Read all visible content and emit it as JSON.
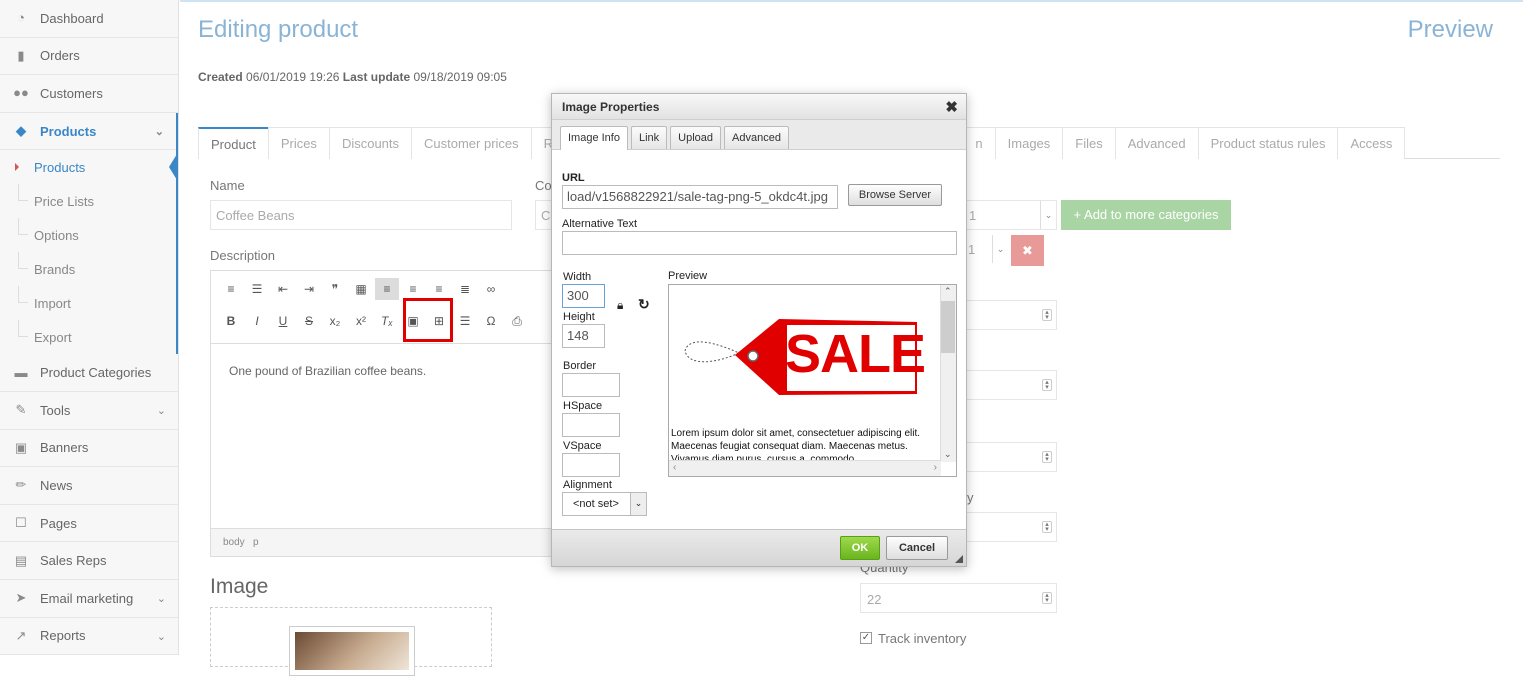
{
  "sidebar": {
    "items": [
      {
        "label": "Dashboard",
        "icon": "dashboard-icon"
      },
      {
        "label": "Orders",
        "icon": "file-icon"
      },
      {
        "label": "Customers",
        "icon": "users-icon"
      },
      {
        "label": "Products",
        "icon": "tag-icon"
      },
      {
        "label": "Product Categories",
        "icon": "folder-icon"
      },
      {
        "label": "Tools",
        "icon": "wrench-icon"
      },
      {
        "label": "Banners",
        "icon": "image-icon"
      },
      {
        "label": "News",
        "icon": "pencil-icon"
      },
      {
        "label": "Pages",
        "icon": "edit-icon"
      },
      {
        "label": "Sales Reps",
        "icon": "briefcase-icon"
      },
      {
        "label": "Email marketing",
        "icon": "send-icon"
      },
      {
        "label": "Reports",
        "icon": "chart-icon"
      }
    ],
    "product_sub": [
      "Products",
      "Price Lists",
      "Options",
      "Brands",
      "Import",
      "Export"
    ]
  },
  "header": {
    "title": "Editing product",
    "preview": "Preview",
    "created_label": "Created",
    "created_value": "06/01/2019 19:26",
    "updated_label": "Last update",
    "updated_value": "09/18/2019 09:05"
  },
  "tabs": [
    "Product",
    "Prices",
    "Discounts",
    "Customer prices",
    "Rela",
    "n",
    "Images",
    "Files",
    "Advanced",
    "Product status rules",
    "Access"
  ],
  "form": {
    "name_label": "Name",
    "name_value": "Coffee Beans",
    "code_label": "Co",
    "code_value": "CF",
    "description_label": "Description",
    "description_text": "One pound of Brazilian coffee beans.",
    "path_body": "body",
    "path_p": "p",
    "image_title": "Image",
    "add_categories": "+ Add to more categories",
    "category_select": "1",
    "category_select2": "1",
    "partial_label": "y",
    "quantity_label": "Quantity",
    "quantity_value": "22",
    "track_inventory": "Track inventory"
  },
  "dialog": {
    "title": "Image Properties",
    "tabs": [
      "Image Info",
      "Link",
      "Upload",
      "Advanced"
    ],
    "url_label": "URL",
    "url_value": "load/v1568822921/sale-tag-png-5_okdc4t.jpg",
    "browse": "Browse Server",
    "alt_label": "Alternative Text",
    "alt_value": "",
    "width_label": "Width",
    "width_value": "300",
    "height_label": "Height",
    "height_value": "148",
    "border_label": "Border",
    "hspace_label": "HSpace",
    "vspace_label": "VSpace",
    "alignment_label": "Alignment",
    "alignment_value": "<not set>",
    "preview_label": "Preview",
    "sale_text": "SALE",
    "lorem": "Lorem ipsum dolor sit amet, consectetuer adipiscing elit. Maecenas feugiat consequat diam. Maecenas metus. Vivamus diam purus, cursus a, commodo",
    "ok": "OK",
    "cancel": "Cancel"
  },
  "colors": {
    "accent": "#3a87c7",
    "ok_green": "#69b51e",
    "sale_red": "#e00000"
  }
}
